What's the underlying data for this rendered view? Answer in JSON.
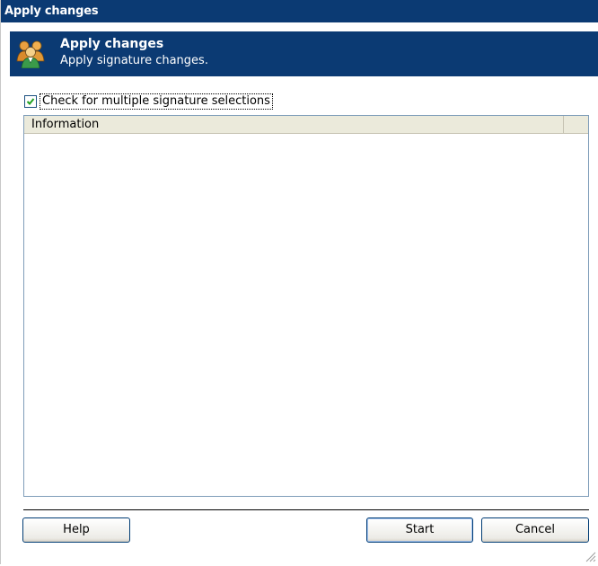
{
  "window": {
    "title": "Apply changes"
  },
  "header": {
    "title": "Apply changes",
    "subtitle": "Apply signature changes.",
    "icon": "users-icon"
  },
  "options": {
    "multi_select_check": {
      "label": "Check for multiple signature selections",
      "checked": true
    }
  },
  "list": {
    "columns": [
      "Information"
    ],
    "rows": []
  },
  "buttons": {
    "help": "Help",
    "start": "Start",
    "cancel": "Cancel"
  },
  "colors": {
    "title_bg": "#0b3a73",
    "header_bg": "#0b3a73",
    "list_border": "#7f9db9",
    "button_border": "#003c74"
  }
}
